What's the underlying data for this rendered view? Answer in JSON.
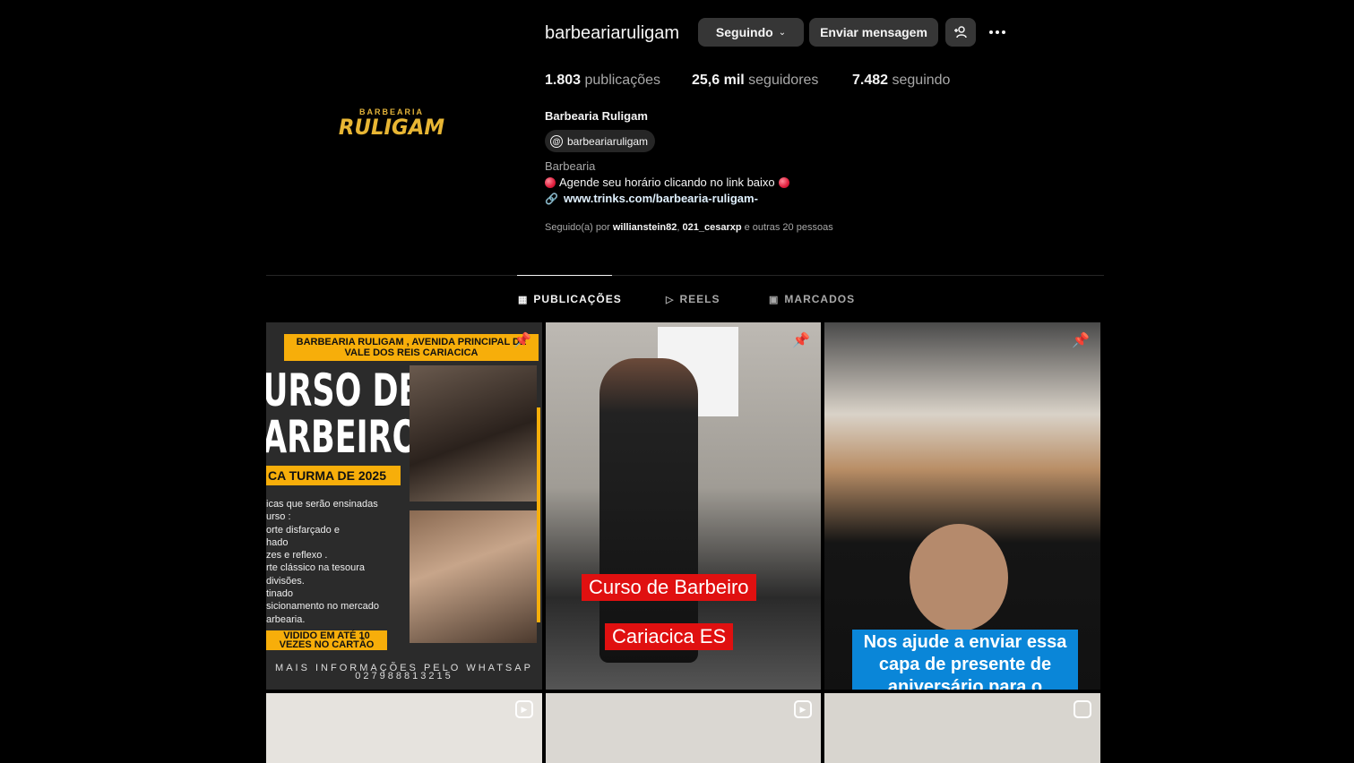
{
  "profile": {
    "username": "barbeariaruligam",
    "follow_label": "Seguindo",
    "message_label": "Enviar mensagem",
    "stats": {
      "posts_num": "1.803",
      "posts_label": "publicações",
      "followers_num": "25,6 mil",
      "followers_label": "seguidores",
      "following_num": "7.482",
      "following_label": "seguindo"
    },
    "full_name": "Barbearia Ruligam",
    "threads_handle": "barbeariaruligam",
    "category": "Barbearia",
    "bio": "Agende seu horário clicando no link baixo",
    "link": "www.trinks.com/barbearia-ruligam-",
    "followed_by_prefix": "Seguido(a) por",
    "followed_by_1": "willianstein82",
    "followed_by_2": "021_cesarxp",
    "followed_by_suffix": "e outras 20 pessoas",
    "logo_small": "BARBEARIA",
    "logo_big": "RULIGAM"
  },
  "tabs": [
    {
      "label": "PUBLICAÇÕES",
      "icon": "grid-icon",
      "active": true
    },
    {
      "label": "REELS",
      "icon": "reels-icon",
      "active": false
    },
    {
      "label": "MARCADOS",
      "icon": "tagged-icon",
      "active": false
    }
  ],
  "posts": {
    "p1": {
      "banner": "BARBEARIA RULIGAM , AVENIDA PRINCIPAL DE VALE DOS REIS CARIACICA",
      "title1": "URSO DE",
      "title2": "ARBEIRO",
      "turma": "CA TURMA DE 2025",
      "list": [
        "icas que serão ensinadas",
        "urso :",
        "orte disfarçado e",
        "hado",
        "zes e reflexo .",
        "rte clássico na tesoura",
        "divisões.",
        "tinado",
        "sicionamento no mercado",
        "arbearia."
      ],
      "parcel": "VIDIDO EM ATÉ 10 VEZES NO CARTÃO",
      "info": "MAIS INFORMAÇÕES PELO WHATSAP 027988813215"
    },
    "p2": {
      "caption1": "Curso de Barbeiro",
      "caption2": "Cariacica ES"
    },
    "p3": {
      "caption": "Nos ajude a enviar essa capa de presente de aniversário para o"
    }
  },
  "colors": {
    "accent": "#f7ae0a",
    "background": "#000000",
    "button": "#363636"
  }
}
